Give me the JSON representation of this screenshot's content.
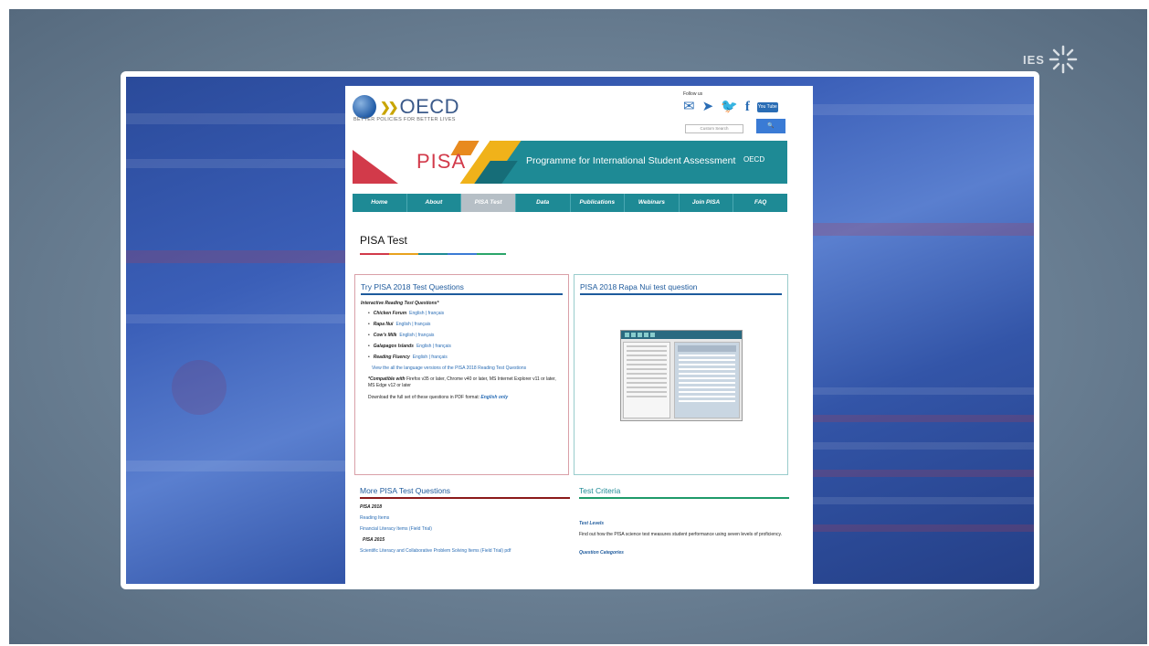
{
  "brand": {
    "ies_logo_text": "IES"
  },
  "oecd": {
    "logo_word": "OECD",
    "tagline": "BETTER POLICIES FOR BETTER LIVES",
    "follow_label": "Follow us",
    "search_placeholder": "Custom Search",
    "youtube_label": "You Tube"
  },
  "banner": {
    "pisa_word": "PISA",
    "title": "Programme for International Student Assessment",
    "oecd_mark": "OECD"
  },
  "nav": [
    {
      "label": "Home",
      "active": false
    },
    {
      "label": "About",
      "active": false
    },
    {
      "label": "PISA Test",
      "active": true
    },
    {
      "label": "Data",
      "active": false
    },
    {
      "label": "Publications",
      "active": false
    },
    {
      "label": "Webinars",
      "active": false
    },
    {
      "label": "Join PISA",
      "active": false
    },
    {
      "label": "FAQ",
      "active": false
    }
  ],
  "page_title": "PISA Test",
  "try_box": {
    "title": "Try PISA 2018 Test Questions",
    "subtitle": "Interactive Reading Test Questions*",
    "items": [
      {
        "name": "Chicken Forum",
        "links": "English | français"
      },
      {
        "name": "Rapa Nui",
        "links": "English | français"
      },
      {
        "name": "Cow's Milk",
        "links": "English | français"
      },
      {
        "name": "Galapagos Islands",
        "links": "English | français"
      },
      {
        "name": "Reading Fluency",
        "links": "English | français"
      }
    ],
    "all_versions_link": "View the all the language versions of the PISA 2018 Reading Test Questions",
    "compat_bold": "*Compatible with",
    "compat_text": "Firefox v35 or later, Chrome v40 or later, MS Internet Explorer v11 or later, MS Edge v12 or later",
    "download_text": "Download the full set of these questions in PDF format:",
    "download_link": "English only"
  },
  "rapa_box": {
    "title": "PISA 2018 Rapa Nui test question"
  },
  "more_section": {
    "title": "More PISA Test Questions",
    "year_2018": "PISA 2018",
    "links_2018": [
      "Reading Items",
      "Financial Literacy Items (Field Trial)"
    ],
    "year_2015": "PISA 2015",
    "links_2015": [
      "Scientific Literacy and Collaborative Problem Solving Items (Field Trial) pdf"
    ]
  },
  "criteria_section": {
    "title": "Test Criteria",
    "levels_heading": "Test Levels",
    "levels_text": "Find out how the PISA science test measures student performance using seven levels of proficiency.",
    "categories_heading": "Question Categories"
  }
}
